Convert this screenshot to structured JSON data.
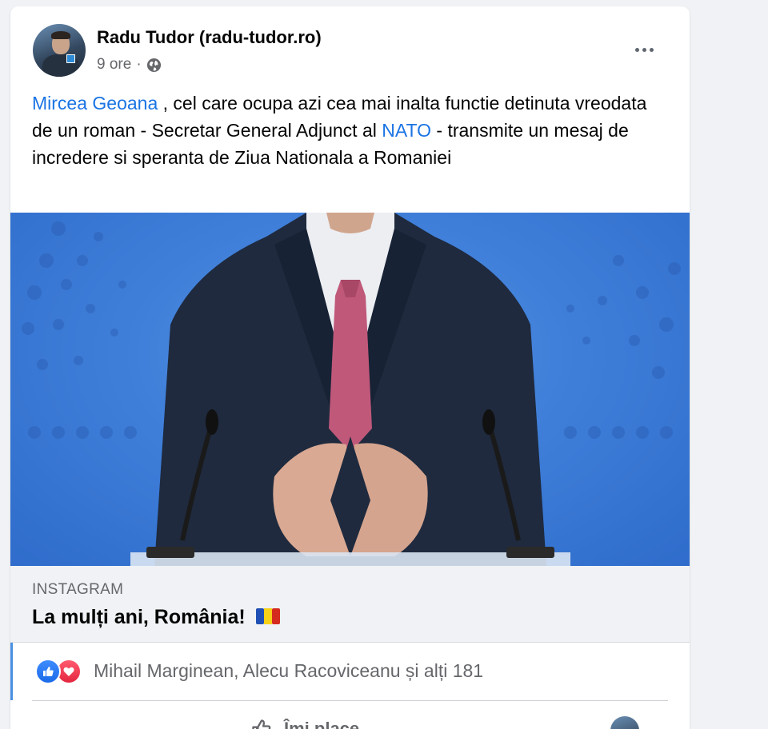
{
  "post": {
    "author": "Radu Tudor (radu-tudor.ro)",
    "time": "9 ore",
    "separator": "·",
    "audience_icon": "globe-icon",
    "more_icon": "more-options-icon",
    "text": {
      "mention_1": "Mircea Geoana",
      "part_1": " , cel care ocupa azi cea mai inalta functie detinuta vreodata de un roman - Secretar General Adjunct al ",
      "mention_2": "NATO",
      "part_2": " - transmite un mesaj de incredere si speranta de Ziua Nationala a Romaniei"
    }
  },
  "link_preview": {
    "source": "INSTAGRAM",
    "title": "La mulți ani, România!",
    "flag_icon": "romania-flag-icon"
  },
  "reactions": {
    "icons": [
      "like-reaction-icon",
      "love-reaction-icon"
    ],
    "summary": "Mihail Marginean, Alecu Racoviceanu și alți 181"
  },
  "actions": {
    "like_label": "Îmi place"
  },
  "colors": {
    "link": "#1b74e4",
    "photo_background": "#3f7fd9",
    "secondary_text": "#65676b"
  }
}
